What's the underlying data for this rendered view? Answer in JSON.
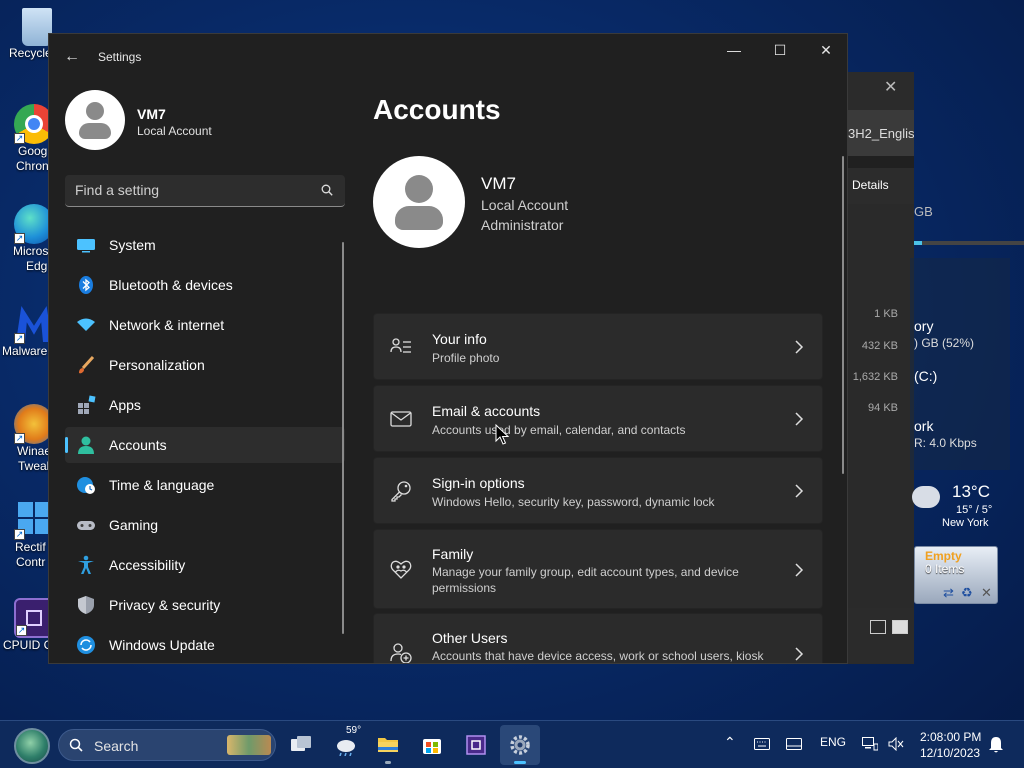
{
  "desktop": {
    "icons": [
      {
        "label": "Recycle"
      },
      {
        "label": "Goog"
      },
      {
        "label": "Chron"
      },
      {
        "label": "Micros"
      },
      {
        "label": "Edg"
      },
      {
        "label": "Malware"
      },
      {
        "label": "Winae"
      },
      {
        "label": "Tweak"
      },
      {
        "label": "Rectif"
      },
      {
        "label": "Contr"
      },
      {
        "label": "CPUID C"
      }
    ]
  },
  "background_window": {
    "tab_text": "3H2_Englis",
    "details_label": "Details",
    "gb_label": "GB",
    "sizes": [
      "1 KB",
      "432 KB",
      "1,632 KB",
      "94 KB"
    ]
  },
  "widgets": {
    "memory_label": "ory",
    "memory_value": ") GB (52%)",
    "disk_label": "(C:)",
    "network_label": "ork",
    "network_value": "R: 4.0 Kbps",
    "weather_temp": "13°C",
    "weather_range": "15° / 5°",
    "weather_city": "New York",
    "bin_status": "Empty",
    "bin_items": "0 Items"
  },
  "window": {
    "title": "Settings",
    "back_label": "←",
    "controls": {
      "minimize": "—",
      "maximize": "☐",
      "close": "✕"
    }
  },
  "profile": {
    "name": "VM7",
    "type": "Local Account"
  },
  "search": {
    "placeholder": "Find a setting"
  },
  "nav": {
    "items": [
      {
        "label": "System"
      },
      {
        "label": "Bluetooth & devices"
      },
      {
        "label": "Network & internet"
      },
      {
        "label": "Personalization"
      },
      {
        "label": "Apps"
      },
      {
        "label": "Accounts"
      },
      {
        "label": "Time & language"
      },
      {
        "label": "Gaming"
      },
      {
        "label": "Accessibility"
      },
      {
        "label": "Privacy & security"
      },
      {
        "label": "Windows Update"
      }
    ],
    "active": "Accounts"
  },
  "main": {
    "title": "Accounts",
    "account": {
      "name": "VM7",
      "type": "Local Account",
      "role": "Administrator"
    },
    "cards": [
      {
        "title": "Your info",
        "desc": "Profile photo",
        "icon": "person-list-icon"
      },
      {
        "title": "Email & accounts",
        "desc": "Accounts used by email, calendar, and contacts",
        "icon": "mail-icon"
      },
      {
        "title": "Sign-in options",
        "desc": "Windows Hello, security key, password, dynamic lock",
        "icon": "key-icon"
      },
      {
        "title": "Family",
        "desc": "Manage your family group, edit account types, and device permissions",
        "icon": "heart-people-icon"
      },
      {
        "title": "Other Users",
        "desc": "Accounts that have device access, work or school users, kiosk assigned access",
        "icon": "person-add-icon"
      }
    ]
  },
  "taskbar": {
    "search_label": "Search",
    "weather_badge": "59°",
    "language": "ENG",
    "time": "2:08:00 PM",
    "date": "12/10/2023"
  },
  "colors": {
    "accent": "#4cc2ff",
    "window_bg": "#202020",
    "card_bg": "#2b2b2b",
    "taskbar_bg": "#0e2a5c"
  }
}
